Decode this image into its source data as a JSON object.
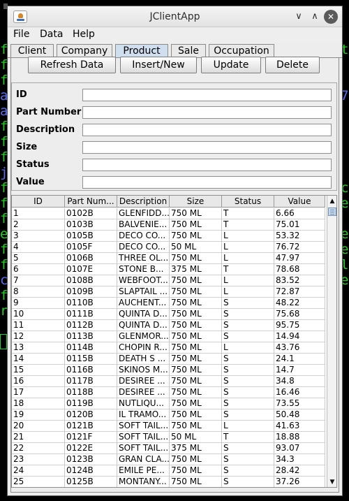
{
  "window": {
    "title": "JClientApp",
    "minimize_glyph": "∨",
    "maximize_glyph": "∧",
    "close_glyph": "✕"
  },
  "menu": [
    "File",
    "Data",
    "Help"
  ],
  "tabs": [
    {
      "label": "Client",
      "active": false
    },
    {
      "label": "Company",
      "active": false
    },
    {
      "label": "Product",
      "active": true
    },
    {
      "label": "Sale",
      "active": false
    },
    {
      "label": "Occupation",
      "active": false
    }
  ],
  "buttons": {
    "refresh": "Refresh Data",
    "insert": "Insert/New",
    "update": "Update",
    "delete": "Delete"
  },
  "form": {
    "id_label": "ID",
    "id_value": "",
    "part_label": "Part Number",
    "part_value": "",
    "desc_label": "Description",
    "desc_value": "",
    "size_label": "Size",
    "size_value": "",
    "status_label": "Status",
    "status_value": "",
    "value_label": "Value",
    "value_value": ""
  },
  "table": {
    "columns": [
      "ID",
      "Part Num...",
      "Description",
      "Size",
      "Status",
      "Value"
    ],
    "rows": [
      [
        "1",
        "0102B",
        "GLENFIDD...",
        "750 ML",
        "T",
        "6.66"
      ],
      [
        "2",
        "0103B",
        "BALVENIE...",
        "750 ML",
        "T",
        "75.01"
      ],
      [
        "3",
        "0105B",
        "DECO CO...",
        "750 ML",
        "L",
        "53.32"
      ],
      [
        "4",
        "0105F",
        "DECO CO...",
        "50 ML",
        "L",
        "76.72"
      ],
      [
        "5",
        "0106B",
        "THREE OL...",
        "750 ML",
        "L",
        "47.97"
      ],
      [
        "6",
        "0107E",
        "STONE B...",
        "375 ML",
        "T",
        "78.68"
      ],
      [
        "7",
        "0108B",
        "WEBFOOT...",
        "750 ML",
        "L",
        "83.52"
      ],
      [
        "8",
        "0109B",
        "SLAPTAIL ...",
        "750 ML",
        "L",
        "72.87"
      ],
      [
        "9",
        "0110B",
        "AUCHENT...",
        "750 ML",
        "S",
        "48.22"
      ],
      [
        "10",
        "0111B",
        "QUINTA D...",
        "750 ML",
        "S",
        "75.68"
      ],
      [
        "11",
        "0112B",
        "QUINTA D...",
        "750 ML",
        "S",
        "95.75"
      ],
      [
        "12",
        "0113B",
        "GLENMOR...",
        "750 ML",
        "S",
        "14.94"
      ],
      [
        "13",
        "0114B",
        "CHOPIN R...",
        "750 ML",
        "L",
        "43.76"
      ],
      [
        "14",
        "0115B",
        "DEATH S ...",
        "750 ML",
        "S",
        "24.1"
      ],
      [
        "15",
        "0116B",
        "SKINOS M...",
        "750 ML",
        "S",
        "14.7"
      ],
      [
        "16",
        "0117B",
        "DESIREE ...",
        "750 ML",
        "S",
        "34.8"
      ],
      [
        "17",
        "0118B",
        "DESIREE ...",
        "750 ML",
        "S",
        "16.46"
      ],
      [
        "18",
        "0119B",
        "NUTLIQU...",
        "750 ML",
        "S",
        "73.55"
      ],
      [
        "19",
        "0120B",
        "IL TRAMO...",
        "750 ML",
        "S",
        "50.48"
      ],
      [
        "20",
        "0121B",
        "SOFT TAIL...",
        "750 ML",
        "L",
        "41.63"
      ],
      [
        "21",
        "0121F",
        "SOFT TAIL...",
        "50 ML",
        "T",
        "18.88"
      ],
      [
        "22",
        "0122E",
        "SOFT TAIL...",
        "375 ML",
        "S",
        "93.07"
      ],
      [
        "23",
        "0123B",
        "GRAN CLA...",
        "750 ML",
        "S",
        "34.3"
      ],
      [
        "24",
        "0124B",
        "EMILE PE...",
        "750 ML",
        "S",
        "28.42"
      ],
      [
        "25",
        "0125B",
        "MONTANY...",
        "750 ML",
        "S",
        "37.26"
      ]
    ]
  },
  "scrollbar": {
    "up_glyph": "▲",
    "down_glyph": "▼"
  },
  "terminal": {
    "left": [
      "f",
      "f",
      "f",
      "a",
      "a",
      "f",
      "f",
      "f",
      "j",
      "f",
      "f",
      "f",
      "e",
      "f",
      "f",
      "c",
      "f",
      "r"
    ],
    "right": [
      "t",
      "",
      "",
      "7",
      "",
      "",
      "",
      "",
      "",
      "c",
      "e",
      "",
      "e",
      "e",
      "l",
      "e"
    ]
  },
  "colors": {
    "terminal_green": "#22d022",
    "terminal_blue": "#5a6cf0",
    "active_tab": "#cfdff0"
  }
}
